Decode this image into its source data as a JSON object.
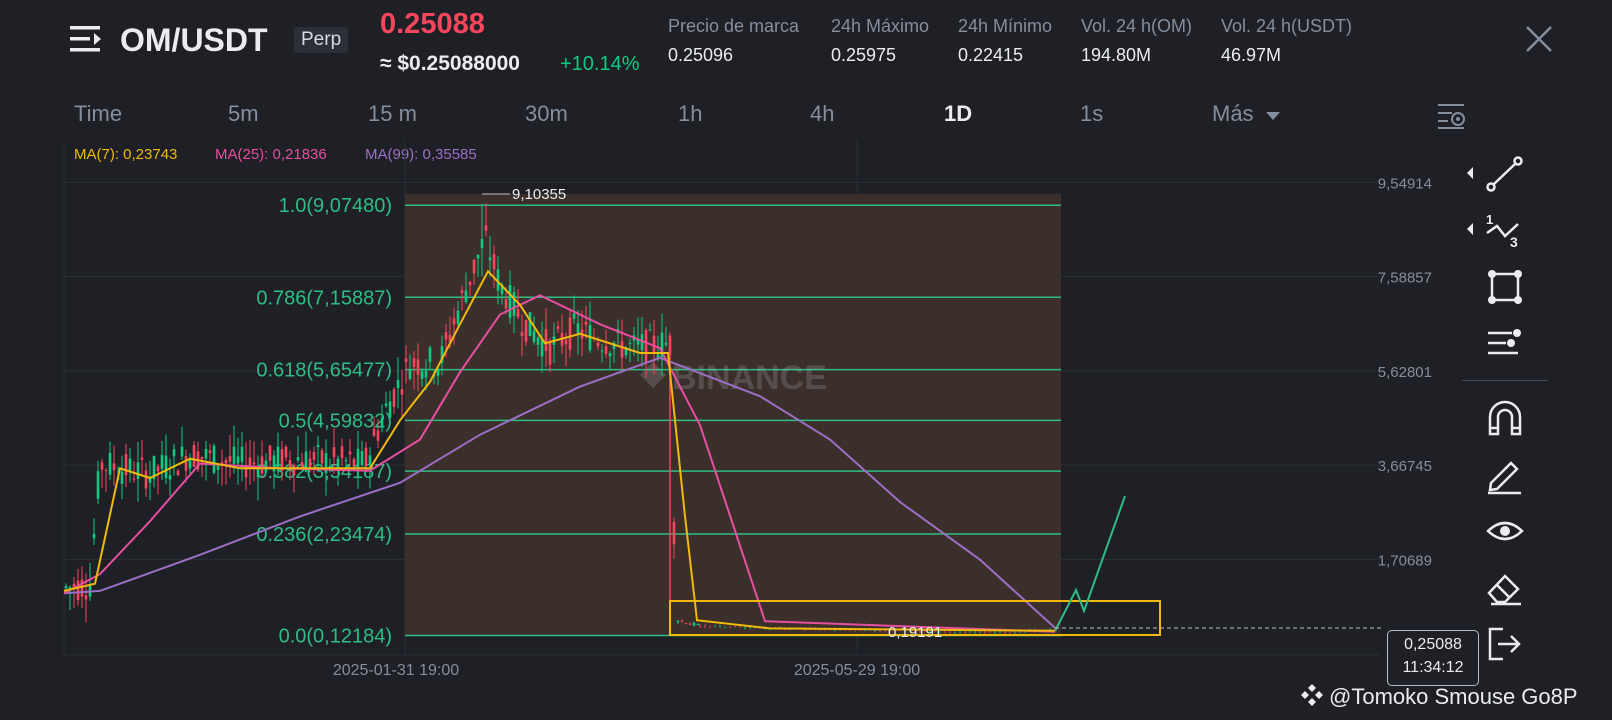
{
  "header": {
    "pair": "OM/USDT",
    "contract_type": "Perp",
    "last_price": "0.25088",
    "usd_price": "≈ $0.25088000",
    "change_pct": "+10.14%",
    "stats": [
      {
        "label": "Precio de marca",
        "value": "0.25096"
      },
      {
        "label": "24h Máximo",
        "value": "0.25975"
      },
      {
        "label": "24h Mínimo",
        "value": "0.22415"
      },
      {
        "label": "Vol. 24 h(OM)",
        "value": "194.80M"
      },
      {
        "label": "Vol. 24 h(USDT)",
        "value": "46.97M"
      }
    ]
  },
  "tabs": [
    "Time",
    "5m",
    "15 m",
    "30m",
    "1h",
    "4h",
    "1D",
    "1s",
    "Más"
  ],
  "active_tab": "1D",
  "indicators": {
    "ma7": "MA(7): 0,23743",
    "ma25": "MA(25): 0,21836",
    "ma99": "MA(99): 0,35585"
  },
  "chart": {
    "axis_labels": [
      "9,54914",
      "7,58857",
      "5,62801",
      "3,66745",
      "1,70689"
    ],
    "time_labels": [
      "2025-01-31 19:00",
      "2025-05-29 19:00"
    ],
    "fib_levels": [
      "1.0(9,07480)",
      "0.786(7,15887)",
      "0.618(5,65477)",
      "0.5(4,59832)",
      "0.382(3,54187)",
      "0.236(2,23474)",
      "0.0(0,12184)"
    ],
    "high_label": "9,10355",
    "low_label": "0,19191",
    "watermark": "BINANCE",
    "current_price_tag": "0,25088",
    "countdown": "11:34:12"
  },
  "chart_data": {
    "type": "line",
    "title": "",
    "series": [
      {
        "name": "MA(7)",
        "color": "#f0b90b"
      },
      {
        "name": "MA(25)",
        "color": "#e84fa0"
      },
      {
        "name": "MA(99)",
        "color": "#9b6fc6"
      }
    ],
    "fibonacci": [
      1.0,
      0.786,
      0.618,
      0.5,
      0.382,
      0.236,
      0.0
    ],
    "fib_values": [
      9.0748,
      7.15887,
      5.65477,
      4.59832,
      3.54187,
      2.23474,
      0.12184
    ],
    "y_ticks": [
      9.54914,
      7.58857,
      5.62801,
      3.66745,
      1.70689
    ],
    "ylim": [
      -0.2,
      10.1
    ],
    "x_ticks": [
      "2025-01-31 19:00",
      "2025-05-29 19:00"
    ]
  },
  "credit": "@Tomoko Smouse Go8P",
  "colors": {
    "background": "#1e2026",
    "up": "#0ecb81",
    "down": "#f6465d",
    "fib": "#2ebd85",
    "highlight_box": "#f0b90b"
  },
  "icons": [
    "menu-icon",
    "close-icon",
    "chart-settings-icon",
    "trend-line-icon",
    "fib-tool-icon",
    "shape-icon",
    "indicator-list-icon",
    "magnet-icon",
    "pencil-icon",
    "eye-icon",
    "eraser-icon",
    "exit-icon"
  ]
}
